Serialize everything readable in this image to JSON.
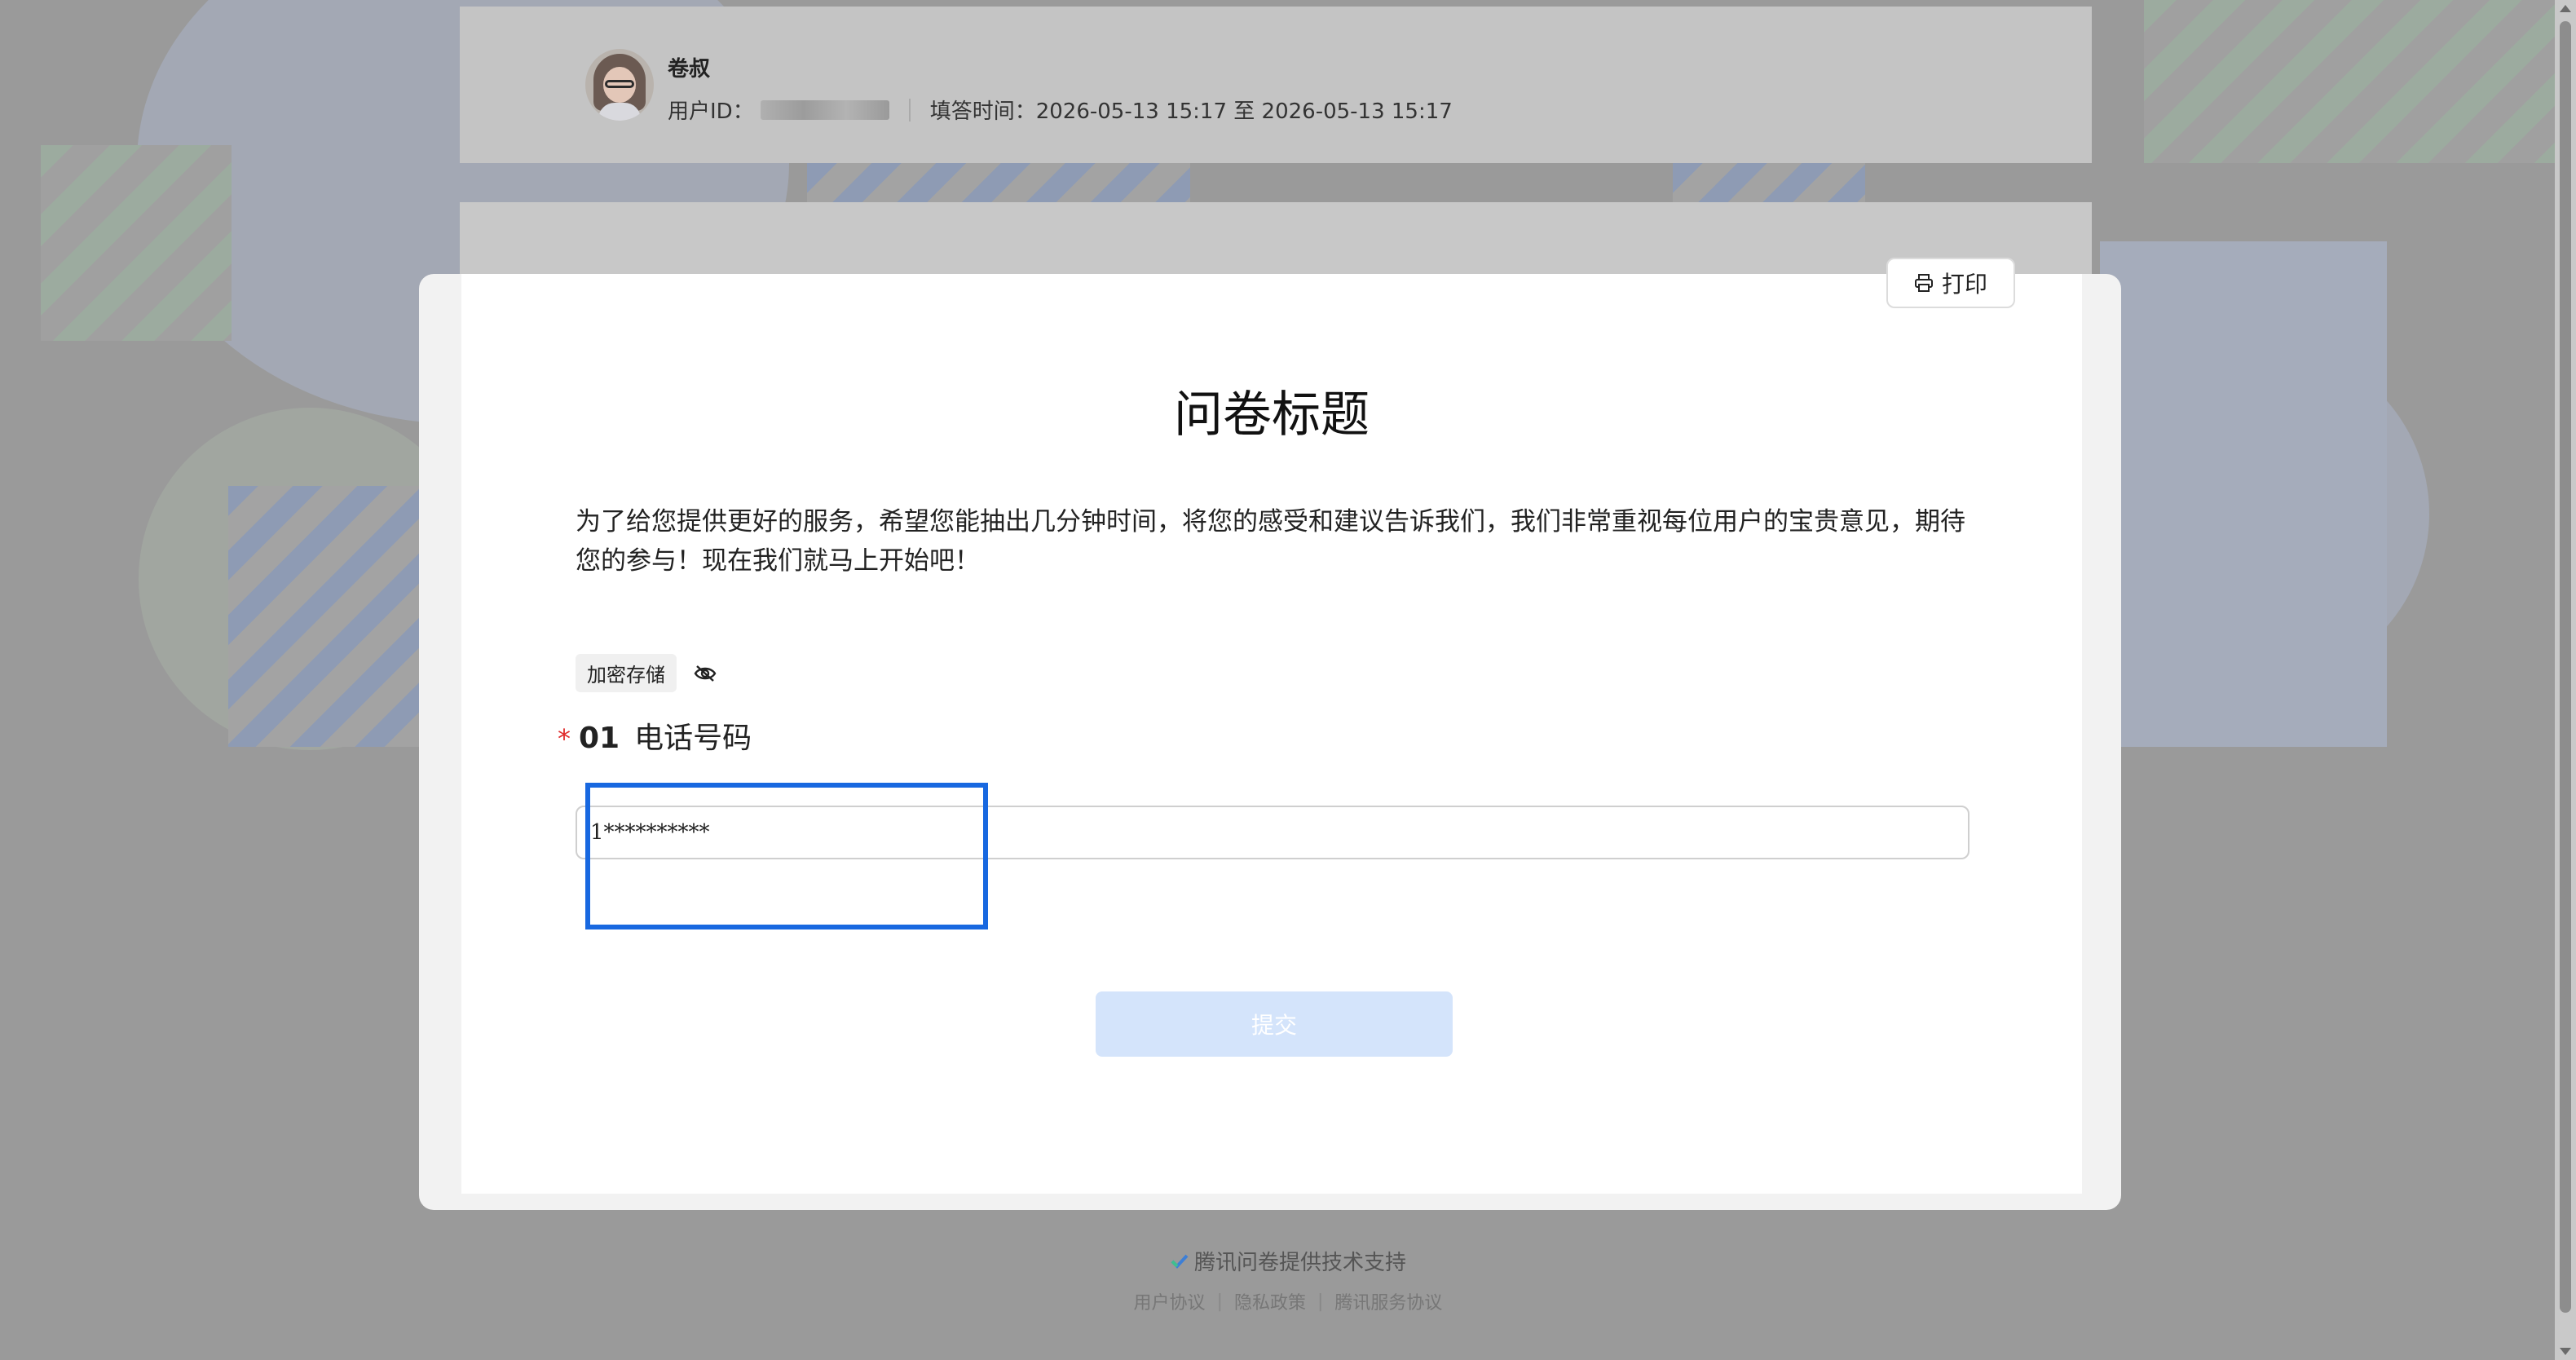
{
  "header": {
    "user_name": "卷叔",
    "user_id_label": "用户ID：",
    "fill_time": "填答时间：2026-05-13 15:17 至 2026-05-13 15:17"
  },
  "modal": {
    "print_label": "打印",
    "title": "问卷标题",
    "description": "为了给您提供更好的服务，希望您能抽出几分钟时间，将您的感受和建议告诉我们，我们非常重视每位用户的宝贵意见，期待您的参与！现在我们就马上开始吧！",
    "tag_encrypt": "加密存储",
    "question": {
      "required_mark": "*",
      "number": "01",
      "title": "电话号码",
      "value": "1**********"
    },
    "submit_label": "提交"
  },
  "footer": {
    "brand": "腾讯问卷提供技术支持",
    "links": [
      "用户协议",
      "隐私政策",
      "腾讯服务协议"
    ],
    "separator": "|"
  },
  "colors": {
    "focus_border": "#1868e0",
    "submit_bg": "#d4e4fb",
    "required": "#e02b2b"
  }
}
